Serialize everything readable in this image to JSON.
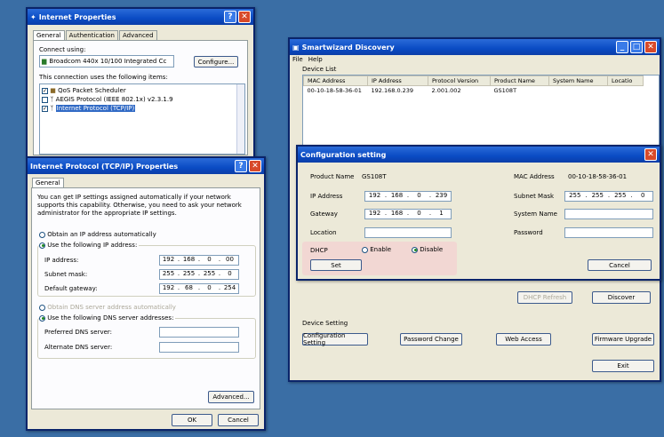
{
  "colors": {
    "desktop": "#3a6ea5",
    "titlebar": "#0a4bc4",
    "dhcp_highlight": "#f2d7d3"
  },
  "ie_props": {
    "title": "Internet Properties",
    "tabs": [
      "General",
      "Authentication",
      "Advanced"
    ],
    "connect_using": "Connect using:",
    "adapter": "Broadcom 440x 10/100 Integrated Cc",
    "configure": "Configure...",
    "uses_items": "This connection uses the following items:",
    "items": [
      {
        "label": "QoS Packet Scheduler",
        "checked": true,
        "selected": false
      },
      {
        "label": "AEGIS Protocol (IEEE 802.1x) v2.3.1.9",
        "checked": false,
        "selected": false
      },
      {
        "label": "Internet Protocol (TCP/IP)",
        "checked": true,
        "selected": true
      }
    ]
  },
  "tcpip": {
    "title": "Internet Protocol (TCP/IP) Properties",
    "tab": "General",
    "intro": "You can get IP settings assigned automatically if your network supports this capability. Otherwise, you need to ask your network administrator for the appropriate IP settings.",
    "obtain_auto": "Obtain an IP address automatically",
    "use_following": "Use the following IP address:",
    "ip_label": "IP address:",
    "ip": [
      "192",
      "168",
      "0",
      "00"
    ],
    "subnet_label": "Subnet mask:",
    "subnet": [
      "255",
      "255",
      "255",
      "0"
    ],
    "gateway_label": "Default gateway:",
    "gateway": [
      "192",
      "68",
      "0",
      "254"
    ],
    "dns_auto": "Obtain DNS server address automatically",
    "dns_following": "Use the following DNS server addresses:",
    "preferred_dns": "Preferred DNS server:",
    "alternate_dns": "Alternate DNS server:",
    "advanced": "Advanced...",
    "ok": "OK",
    "cancel": "Cancel"
  },
  "smart": {
    "title": "Smartwizard Discovery",
    "menu": [
      "File",
      "Help"
    ],
    "device_list": "Device List",
    "columns": [
      "MAC Address",
      "IP Address",
      "Protocol Version",
      "Product Name",
      "System Name",
      "Locatio"
    ],
    "rows": [
      [
        "00-10-18-58-36-01",
        "192.168.0.239",
        "2.001.002",
        "GS108T",
        "",
        ""
      ]
    ],
    "refresh": "DHCP Refresh",
    "discover": "Discover",
    "device_setting": "Device Setting",
    "config_setting": "Configuration Setting",
    "password_change": "Password Change",
    "web_access": "Web Access",
    "firmware": "Firmware Upgrade",
    "exit": "Exit"
  },
  "config": {
    "title": "Configuration setting",
    "product_name_label": "Product Name",
    "product_name": "GS108T",
    "mac_label": "MAC Address",
    "mac": "00-10-18-58-36-01",
    "ip_label": "IP Address",
    "ip": [
      "192",
      "168",
      "0",
      "239"
    ],
    "subnet_label": "Subnet Mask",
    "subnet": [
      "255",
      "255",
      "255",
      "0"
    ],
    "gateway_label": "Gateway",
    "gateway": [
      "192",
      "168",
      "0",
      "1"
    ],
    "system_name_label": "System Name",
    "location_label": "Location",
    "password_label": "Password",
    "dhcp_label": "DHCP",
    "enable": "Enable",
    "disable": "Disable",
    "set": "Set",
    "cancel": "Cancel"
  }
}
